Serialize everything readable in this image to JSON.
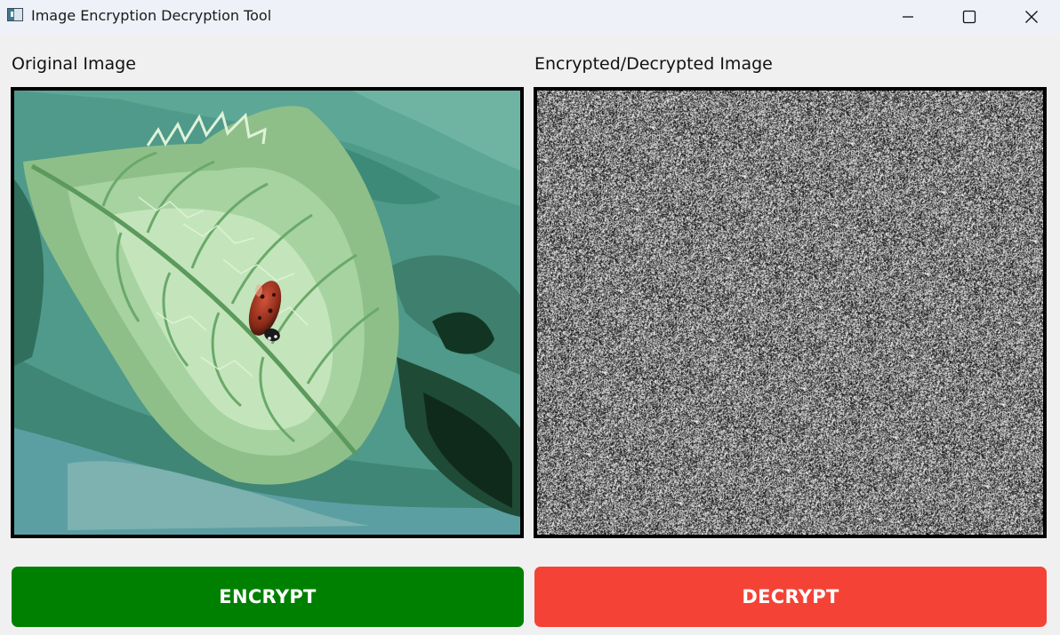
{
  "window": {
    "title": "Image Encryption Decryption Tool",
    "icons": {
      "app": "app-window-icon",
      "minimize": "minimize-icon",
      "maximize": "maximize-icon",
      "close": "close-icon"
    }
  },
  "panels": {
    "original": {
      "label": "Original Image",
      "image": "ladybug-on-leaf-photo"
    },
    "result": {
      "label": "Encrypted/Decrypted Image",
      "image": "random-noise-encrypted"
    }
  },
  "buttons": {
    "encrypt": {
      "label": "ENCRYPT",
      "color": "#008000"
    },
    "decrypt": {
      "label": "DECRYPT",
      "color": "#f44336"
    }
  }
}
